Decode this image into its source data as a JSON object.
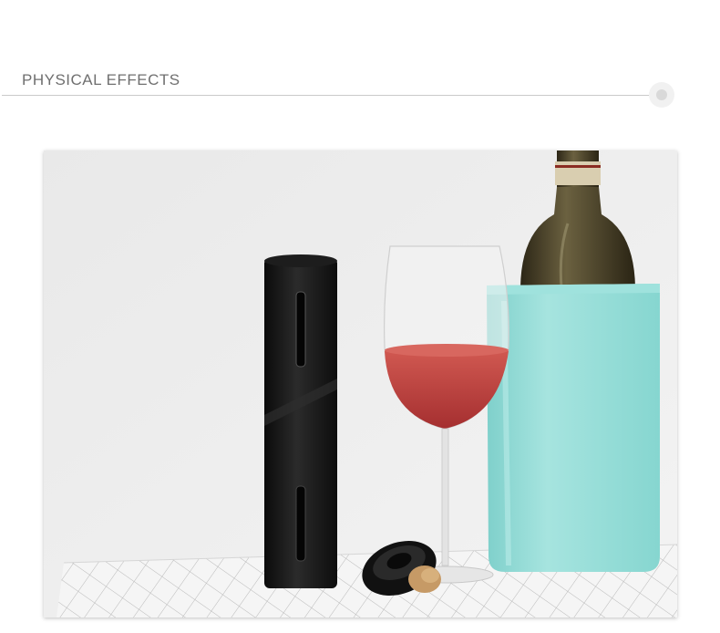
{
  "section": {
    "title": "PHYSICAL EFFECTS"
  },
  "photo": {
    "subject": [
      "wine-bottle",
      "electric-wine-opener",
      "wine-glass",
      "foil-cutter",
      "cork",
      "wine-cooler"
    ],
    "colors": {
      "background": "#ececec",
      "cooler": "#8fd8d3",
      "opener": "#141414",
      "wine": "#c0433f"
    }
  }
}
